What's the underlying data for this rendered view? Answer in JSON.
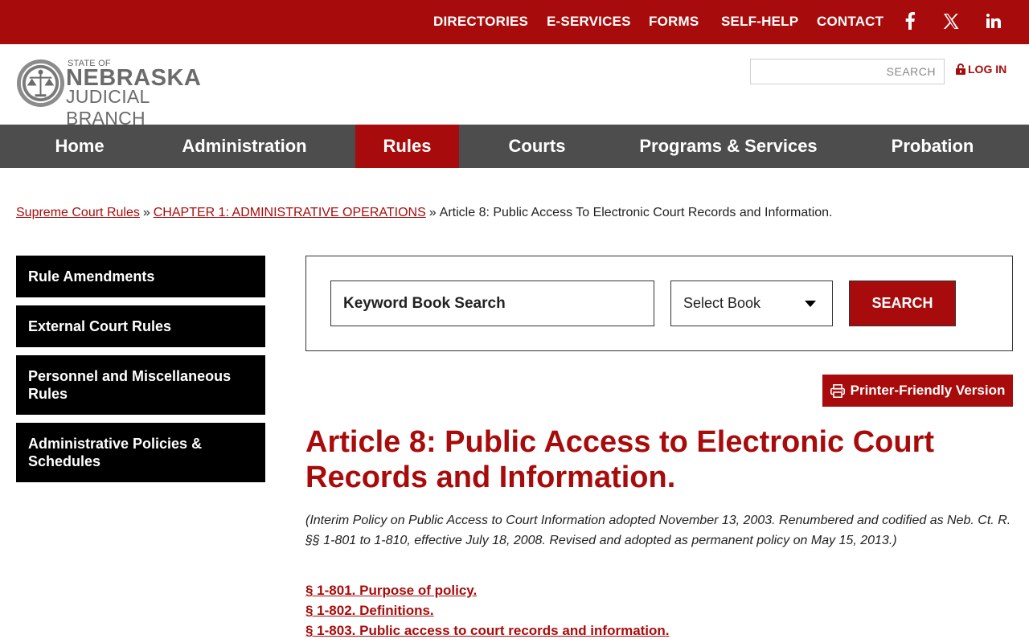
{
  "colors": {
    "brand_red": "#a80b0b",
    "nav_gray": "#4d4d4d",
    "sidebar_black": "#000000"
  },
  "topbar": {
    "links": [
      "DIRECTORIES",
      "E-SERVICES",
      "FORMS",
      "SELF-HELP",
      "CONTACT"
    ],
    "social": [
      "facebook-icon",
      "x-icon",
      "linkedin-icon"
    ]
  },
  "logo": {
    "line1": "STATE OF",
    "line2": "NEBRASKA",
    "line3": "JUDICIAL BRANCH"
  },
  "header": {
    "search_placeholder": "SEARCH",
    "login_label": "LOG IN"
  },
  "nav": {
    "items": [
      "Home",
      "Administration",
      "Rules",
      "Courts",
      "Programs & Services",
      "Probation"
    ],
    "active": "Rules"
  },
  "breadcrumb": {
    "items": [
      "Supreme Court Rules",
      "CHAPTER 1: ADMINISTRATIVE OPERATIONS"
    ],
    "separator": "»",
    "current": "Article 8: Public Access To Electronic Court Records and Information."
  },
  "sidebar": {
    "items": [
      "Rule Amendments",
      "External Court Rules",
      "Personnel and Miscellaneous Rules",
      "Administrative Policies & Schedules"
    ]
  },
  "book_search": {
    "keyword_placeholder": "Keyword Book Search",
    "select_value": "Select Book",
    "button_label": "SEARCH"
  },
  "printer_label": "Printer-Friendly Version",
  "article": {
    "title": "Article 8: Public Access to Electronic Court Records and Information.",
    "note": "(Interim Policy on Public Access to Court Information adopted November 13, 2003. Renumbered and codified as Neb. Ct. R. §§ 1-801 to 1-810, effective July 18, 2008. Revised and adopted as permanent policy on May 15, 2013.)",
    "sections": [
      "§ 1-801. Purpose of policy.",
      "§ 1-802. Definitions.",
      "§ 1-803. Public access to court records and information."
    ]
  }
}
